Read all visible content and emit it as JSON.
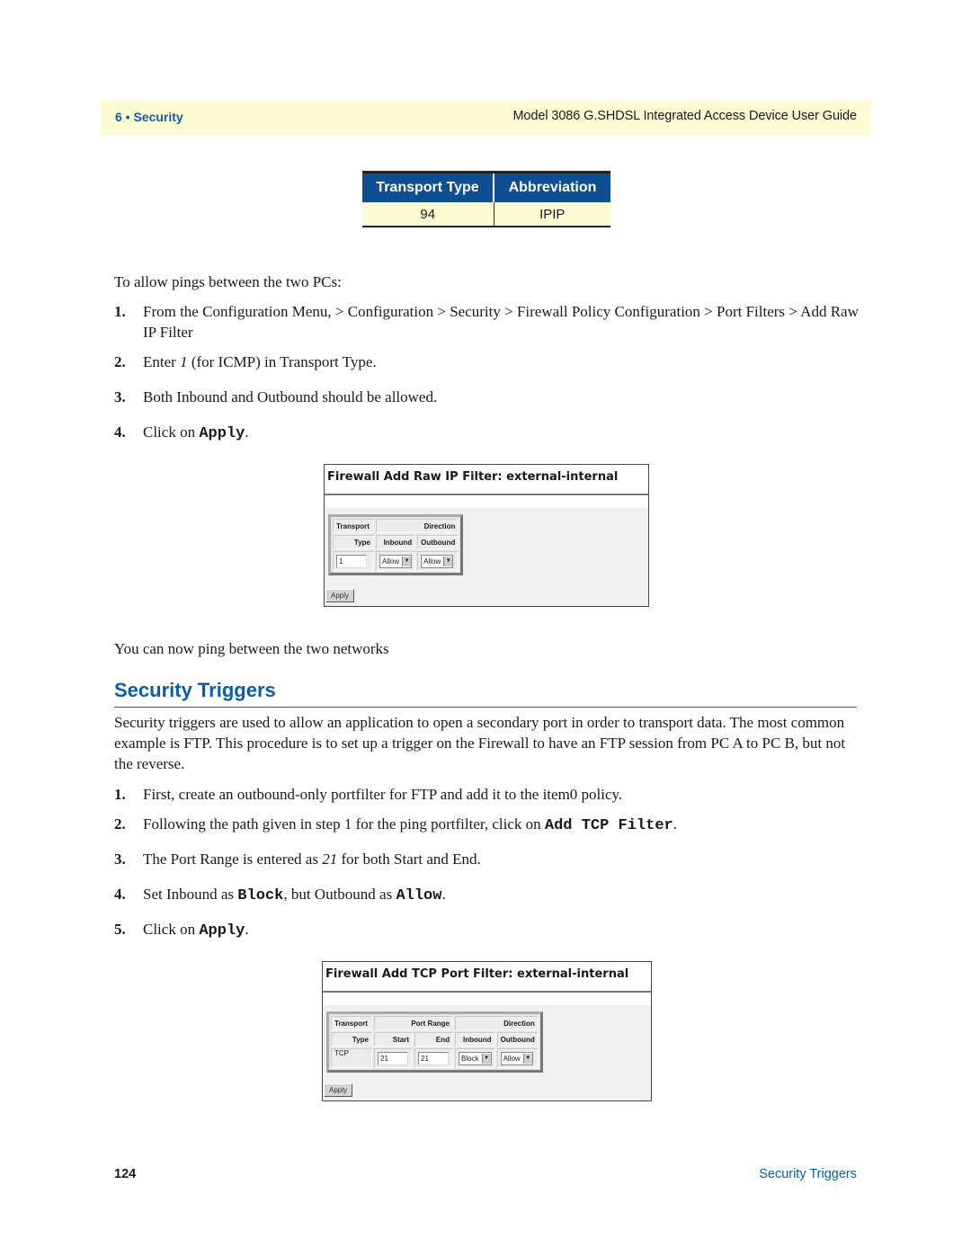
{
  "header": {
    "chapter": "6 • Security",
    "guide_title": "Model 3086 G.SHDSL Integrated Access Device User Guide"
  },
  "abbreviation_table": {
    "columns": [
      "Transport Type",
      "Abbreviation"
    ],
    "rows": [
      [
        "94",
        "IPIP"
      ]
    ]
  },
  "ping_intro": "To allow pings between the two PCs:",
  "ping_steps": [
    {
      "num": "1.",
      "text": "From the Configuration Menu, > Configuration > Security > Firewall Policy Configuration > Port Filters > Add Raw IP Filter"
    },
    {
      "num": "2.",
      "pre": "Enter ",
      "em": "1",
      "post": " (for ICMP) in Transport Type."
    },
    {
      "num": "3.",
      "text": "Both Inbound and Outbound should be allowed."
    },
    {
      "num": "4.",
      "pre": "Click on ",
      "code": "Apply",
      "post": "."
    }
  ],
  "raw_ip_form": {
    "title": "Firewall Add Raw IP Filter: external-internal",
    "header_row1": [
      "Transport",
      "Direction"
    ],
    "header_row2": [
      "Type",
      "Inbound",
      "Outbound"
    ],
    "transport_type_value": "1",
    "inbound_value": "Allow",
    "outbound_value": "Allow",
    "apply_label": "Apply"
  },
  "ping_result": "You can now ping between the two networks",
  "section": {
    "heading": "Security Triggers",
    "intro": "Security triggers are used to allow an application to open a secondary port in order to transport data. The most common example is FTP. This procedure is to set up a trigger on the Firewall to have an FTP session from PC A to PC B, but not the reverse."
  },
  "trigger_steps": [
    {
      "num": "1.",
      "text": "First, create an outbound-only portfilter for FTP and add it to the item0 policy."
    },
    {
      "num": "2.",
      "pre": "Following the path given in step 1 for the ping portfilter, click on ",
      "code": "Add TCP Filter",
      "post": "."
    },
    {
      "num": "3.",
      "pre": "The Port Range is entered as ",
      "em": "21",
      "post": " for both Start and End."
    },
    {
      "num": "4.",
      "pre": "Set Inbound as ",
      "code": "Block",
      "mid": ", but Outbound as ",
      "code2": "Allow",
      "post": "."
    },
    {
      "num": "5.",
      "pre": "Click on ",
      "code": "Apply",
      "post": "."
    }
  ],
  "tcp_form": {
    "title": "Firewall Add TCP Port Filter: external-internal",
    "header_row1": [
      "Transport",
      "Port Range",
      "Direction"
    ],
    "header_row2": [
      "Type",
      "Start",
      "End",
      "Inbound",
      "Outbound"
    ],
    "transport_type_value": "TCP",
    "start_value": "21",
    "end_value": "21",
    "inbound_value": "Block",
    "outbound_value": "Allow",
    "apply_label": "Apply"
  },
  "footer": {
    "page_number": "124",
    "section_name": "Security Triggers"
  },
  "colors": {
    "brand_blue": "#0b5ea8",
    "table_header_bg": "#0d4f92",
    "highlight_yellow": "#fefcd2"
  }
}
